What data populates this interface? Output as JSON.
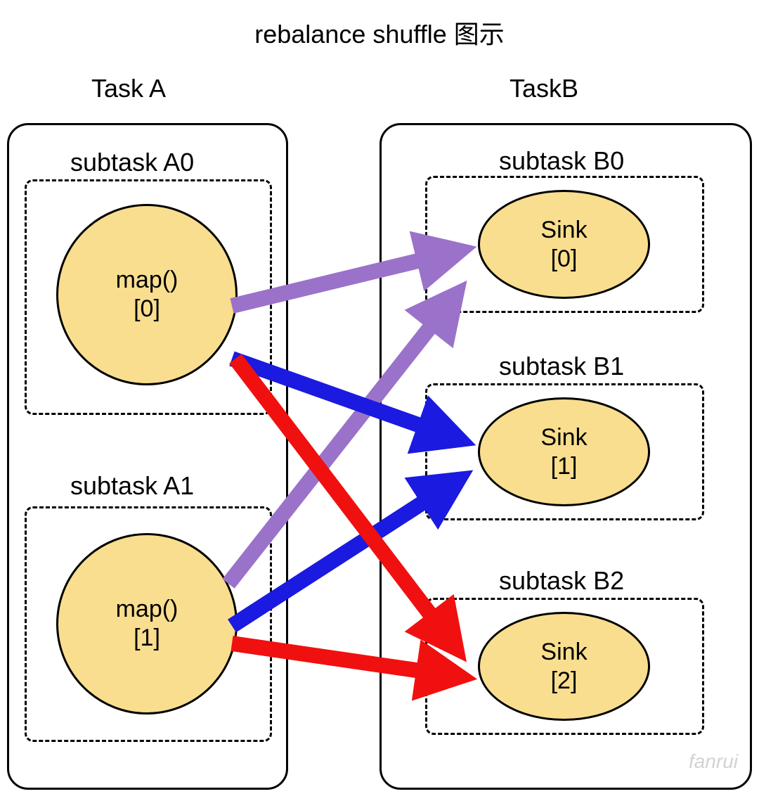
{
  "title": "rebalance shuffle 图示",
  "tasks": {
    "a": {
      "label": "Task A",
      "subtasks": [
        {
          "label": "subtask A0",
          "node": {
            "line1": "map()",
            "line2": "[0]"
          }
        },
        {
          "label": "subtask A1",
          "node": {
            "line1": "map()",
            "line2": "[1]"
          }
        }
      ]
    },
    "b": {
      "label": "TaskB",
      "subtasks": [
        {
          "label": "subtask B0",
          "node": {
            "line1": "Sink",
            "line2": "[0]"
          }
        },
        {
          "label": "subtask B1",
          "node": {
            "line1": "Sink",
            "line2": "[1]"
          }
        },
        {
          "label": "subtask B2",
          "node": {
            "line1": "Sink",
            "line2": "[2]"
          }
        }
      ]
    }
  },
  "arrows": [
    {
      "from": "A0",
      "to": "B0",
      "color": "#9b72c9"
    },
    {
      "from": "A1",
      "to": "B0",
      "color": "#9b72c9"
    },
    {
      "from": "A0",
      "to": "B1",
      "color": "#1a1ae0"
    },
    {
      "from": "A1",
      "to": "B1",
      "color": "#1a1ae0"
    },
    {
      "from": "A0",
      "to": "B2",
      "color": "#f01010"
    },
    {
      "from": "A1",
      "to": "B2",
      "color": "#f01010"
    }
  ],
  "colors": {
    "nodeFill": "#f8de8e",
    "purple": "#9b72c9",
    "blue": "#1a1ae0",
    "red": "#f01010"
  },
  "watermark": "fanrui"
}
